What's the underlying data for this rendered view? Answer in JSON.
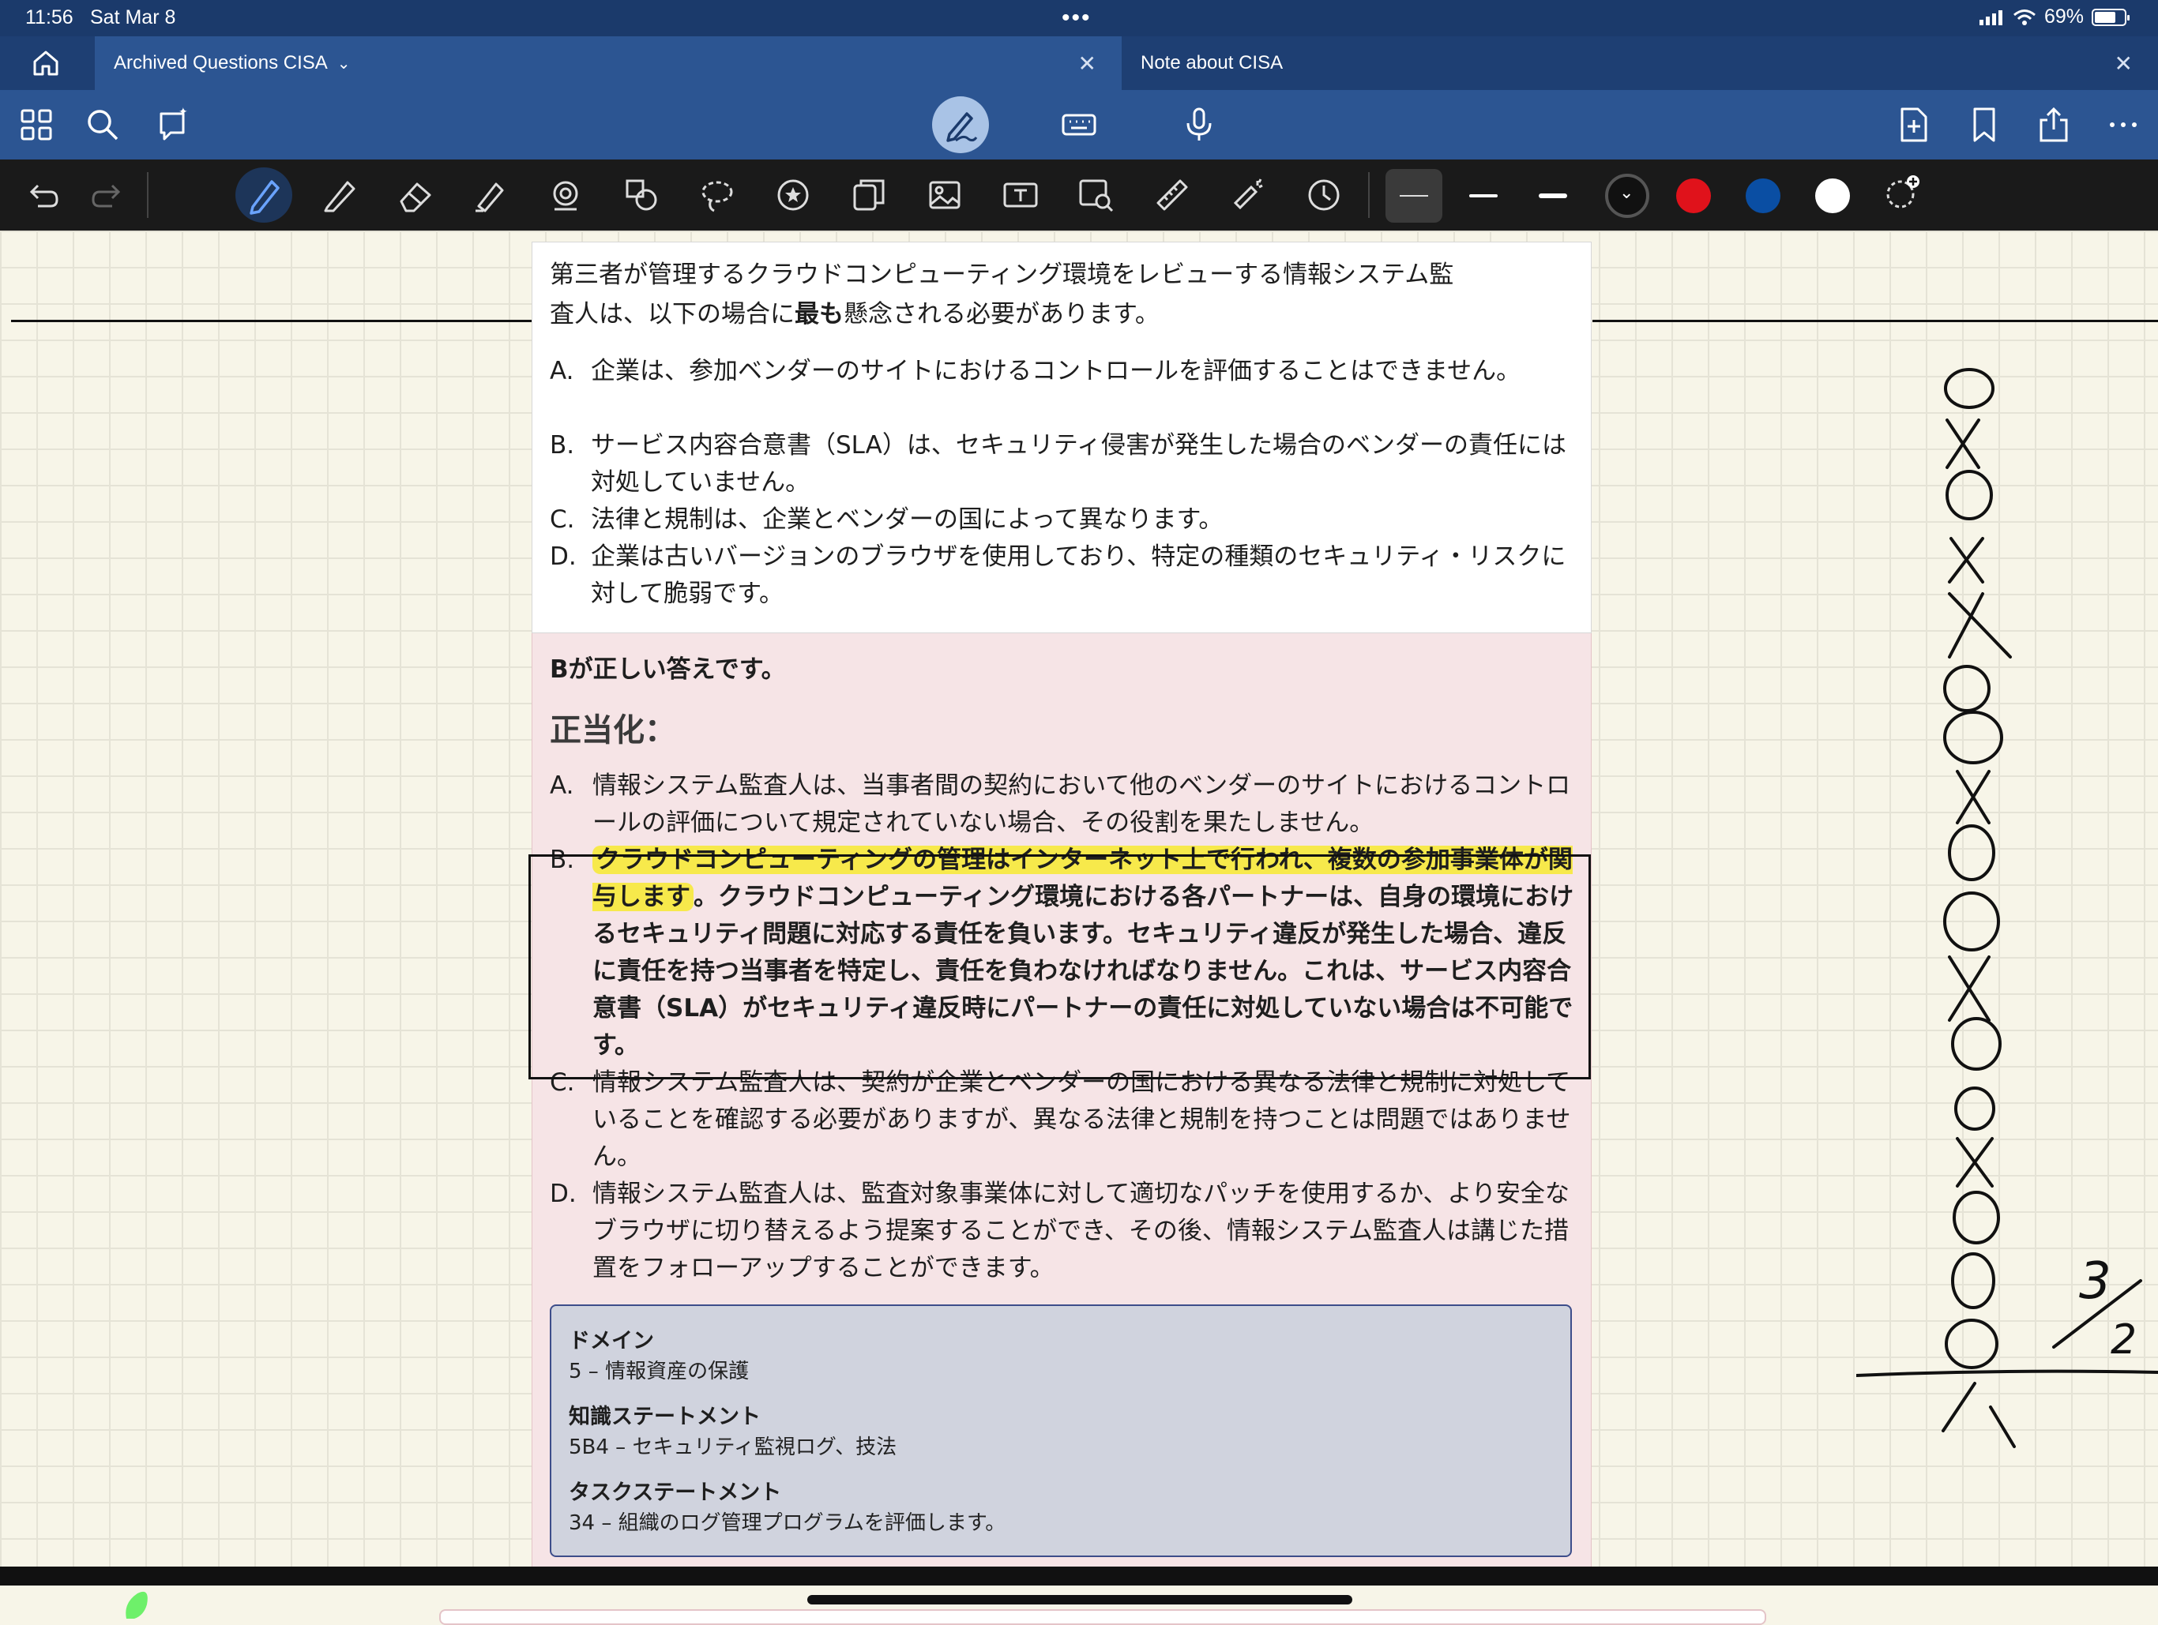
{
  "status": {
    "time": "11:56",
    "date": "Sat Mar 8",
    "battery": "69%"
  },
  "tabs": [
    {
      "label": "Archived Questions CISA",
      "active": true
    },
    {
      "label": "Note about CISA",
      "active": false
    }
  ],
  "question": {
    "line1": "第三者が管理するクラウドコンピューティング環境をレビューする情報システム監",
    "line2_pre": "査人は、以下の場合に",
    "line2_bold": "最も",
    "line2_post": "懸念される必要があります。",
    "options": [
      {
        "letter": "A.",
        "text": "企業は、参加ベンダーのサイトにおけるコントロールを評価することはできません。"
      },
      {
        "letter": "B.",
        "text": "サービス内容合意書（SLA）は、セキュリティ侵害が発生した場合のベンダーの責任には対処していません。"
      },
      {
        "letter": "C.",
        "text": "法律と規制は、企業とベンダーの国によって異なります。"
      },
      {
        "letter": "D.",
        "text": "企業は古いバージョンのブラウザを使用しており、特定の種類のセキュリティ・リスクに対して脆弱です。"
      }
    ]
  },
  "answer": {
    "correct_letter": "B",
    "correct_text": "が正しい答えです。",
    "justification_heading": "正当化：",
    "justifications": [
      {
        "letter": "A.",
        "text": "情報システム監査人は、当事者間の契約において他のベンダーのサイトにおけるコントロールの評価について規定されていない場合、その役割を果たしません。"
      },
      {
        "letter": "B.",
        "highlight": "クラウドコンピューティングの管理はインターネット上で行われ、複数の参加事業体が関与します",
        "text": "。クラウドコンピューティング環境における各パートナーは、自身の環境におけるセキュリティ問題に対応する責任を負います。セキュリティ違反が発生した場合、違反に責任を持つ当事者を特定し、責任を負わなければなりません。これは、サービス内容合意書（SLA）がセキュリティ違反時にパートナーの責任に対処していない場合は不可能です。"
      },
      {
        "letter": "C.",
        "text": "情報システム監査人は、契約が企業とベンダーの国における異なる法律と規制に対処していることを確認する必要がありますが、異なる法律と規制を持つことは問題ではありません。"
      },
      {
        "letter": "D.",
        "text": "情報システム監査人は、監査対象事業体に対して適切なパッチを使用するか、より安全なブラウザに切り替えるよう提案することができ、その後、情報システム監査人は講じた措置をフォローアップすることができます。"
      }
    ]
  },
  "meta": {
    "domain_label": "ドメイン",
    "domain_value": "5 –  情報資産の保護",
    "knowledge_label": "知識ステートメント",
    "knowledge_value": "5B4 – セキュリティ監視ログ、技法",
    "task_label": "タスクステートメント",
    "task_value": "34 – 組織のログ管理プログラムを評価します。"
  },
  "handwriting": {
    "marks": "OXOXXOOXOOOXOOXOOOX",
    "score": "3/2"
  },
  "colors": {
    "navy": "#1b3a6b",
    "toolbar_blue": "#2c5592",
    "pen_black": "#111111",
    "pen_red": "#e0121b",
    "pen_blue": "#0a4ea3",
    "pen_white": "#ffffff",
    "highlight_yellow": "#f7e94b"
  }
}
